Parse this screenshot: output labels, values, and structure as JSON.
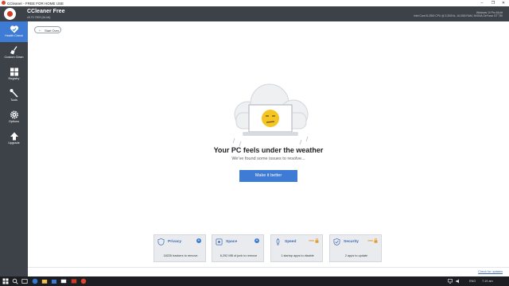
{
  "window": {
    "title": "CCleaner - FREE FOR HOME USE",
    "controls": [
      "–",
      "❐",
      "✕"
    ]
  },
  "header": {
    "app_name": "CCleaner Free",
    "version": "v5.70.7909 (64-bit)",
    "sys_line1": "Windows 10 Pro 64-bit",
    "sys_line2": "Intel Core i5-2500 CPU @ 3.30GHz, 16.0GB RAM, NVIDIA GeForce GT 730"
  },
  "sidebar": {
    "items": [
      {
        "label": "Health Check",
        "icon": "heart-check-icon",
        "active": true
      },
      {
        "label": "Custom Clean",
        "icon": "broom-icon",
        "active": false
      },
      {
        "label": "Registry",
        "icon": "registry-grid-icon",
        "active": false
      },
      {
        "label": "Tools",
        "icon": "wrench-icon",
        "active": false
      },
      {
        "label": "Options",
        "icon": "gear-icon",
        "active": false
      },
      {
        "label": "Upgrade",
        "icon": "upgrade-arrow-icon",
        "active": false
      }
    ]
  },
  "main": {
    "start_over": "Start Over",
    "headline": "Your PC feels under the weather",
    "subline": "We've found some issues to resolve...",
    "action_button": "Make it better"
  },
  "cards": [
    {
      "name": "Privacy",
      "desc": "18226 trackers to remove",
      "icon": "privacy-shield-icon",
      "pro": false
    },
    {
      "name": "Space",
      "desc": "6,292 MB of junk to remove",
      "icon": "space-disk-icon",
      "pro": false
    },
    {
      "name": "Speed",
      "desc": "1 startup apps to disable",
      "icon": "speed-rocket-icon",
      "pro": true,
      "pro_label": "PRO"
    },
    {
      "name": "Security",
      "desc": "2 apps to update",
      "icon": "security-shield-icon",
      "pro": true,
      "pro_label": "PRO"
    }
  ],
  "statusbar": {
    "update_link": "Check for updates"
  },
  "taskbar": {
    "lang": "ENG",
    "time": "7:19 am"
  },
  "colors": {
    "accent": "#3d7bd4",
    "sidebar_bg": "#3d4148",
    "pro": "#e29c2c",
    "face": "#f5c623"
  }
}
